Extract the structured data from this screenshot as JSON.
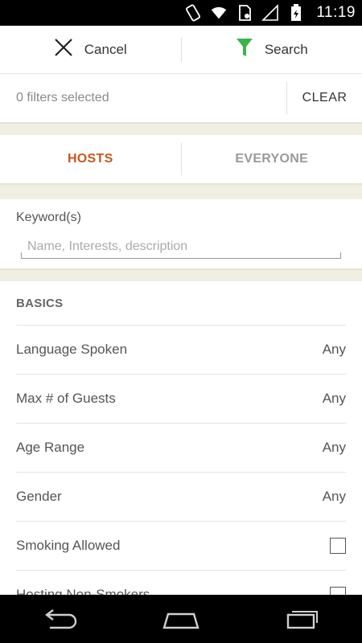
{
  "status_bar": {
    "time": "11:19",
    "icons": [
      "rotate-icon",
      "wifi-icon",
      "sim-icon",
      "signal-icon",
      "battery-icon"
    ]
  },
  "action_bar": {
    "cancel_label": "Cancel",
    "search_label": "Search",
    "search_icon_color": "#3bb54a"
  },
  "filters": {
    "count_text": "0 filters selected",
    "clear_label": "CLEAR"
  },
  "tabs": [
    {
      "label": "HOSTS",
      "active": true
    },
    {
      "label": "EVERYONE",
      "active": false
    }
  ],
  "keyword": {
    "label": "Keyword(s)",
    "placeholder": "Name, Interests, description",
    "value": ""
  },
  "basics": {
    "title": "BASICS",
    "rows": [
      {
        "label": "Language Spoken",
        "value": "Any"
      },
      {
        "label": "Max # of Guests",
        "value": "Any"
      },
      {
        "label": "Age Range",
        "value": "Any"
      },
      {
        "label": "Gender",
        "value": "Any"
      },
      {
        "label": "Smoking Allowed",
        "checked": false
      },
      {
        "label": "Hosting Non-Smokers",
        "checked": false
      }
    ]
  },
  "nav_bar": {
    "icons": [
      "back-icon",
      "home-icon",
      "recents-icon"
    ]
  },
  "colors": {
    "accent": "#c8561c",
    "section_gap": "#f1efe4"
  }
}
